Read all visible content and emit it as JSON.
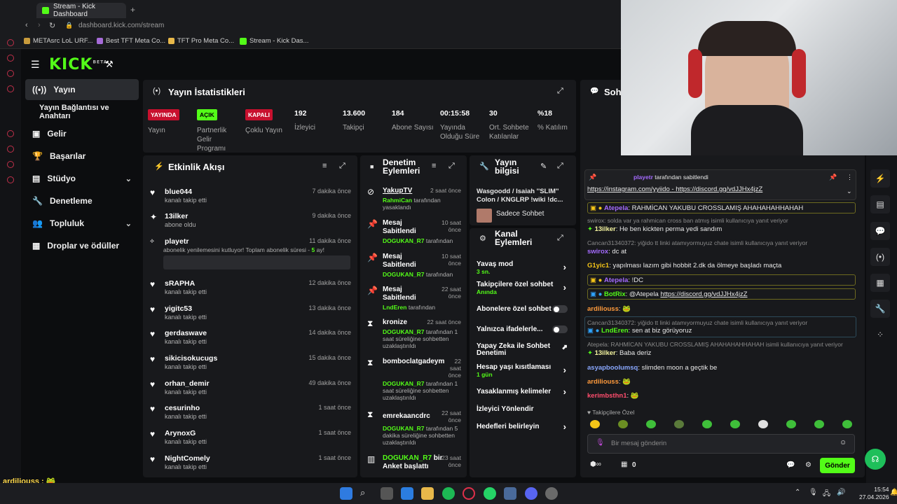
{
  "browser": {
    "tab_title": "Stream - Kick Dashboard",
    "url": "dashboard.kick.com/stream",
    "bookmarks": [
      "METAsrc LoL URF...",
      "Best TFT Meta Co...",
      "TFT Pro Meta Co...",
      "Stream - Kick Das..."
    ]
  },
  "brand": {
    "logo": "KICK",
    "beta": "BETA",
    "accent": "#53fc18"
  },
  "sidebar": {
    "items": [
      {
        "label": "Yayın"
      },
      {
        "label": "Yayın Bağlantısı ve Anahtarı"
      },
      {
        "label": "Gelir"
      },
      {
        "label": "Başarılar"
      },
      {
        "label": "Stüdyo"
      },
      {
        "label": "Denetleme"
      },
      {
        "label": "Topluluk"
      },
      {
        "label": "Droplar ve ödüller"
      }
    ]
  },
  "stats": {
    "title": "Yayın İstatistikleri",
    "items": [
      {
        "value": "YAYINDA",
        "label": "Yayın"
      },
      {
        "value": "AÇIK",
        "label": "Partnerlik Gelir Programı"
      },
      {
        "value": "KAPALI",
        "label": "Çoklu Yayın"
      },
      {
        "value": "192",
        "label": "İzleyici"
      },
      {
        "value": "13.600",
        "label": "Takipçi"
      },
      {
        "value": "184",
        "label": "Abone Sayısı"
      },
      {
        "value": "00:15:58",
        "label": "Yayında Olduğu Süre"
      },
      {
        "value": "30",
        "label": "Ort. Sohbete Katılanlar"
      },
      {
        "value": "%18",
        "label": "% Katılım"
      }
    ]
  },
  "activity": {
    "title": "Etkinlik Akışı",
    "events": [
      {
        "name": "blue044",
        "sub": "kanalı takip etti",
        "time": "7 dakika önce"
      },
      {
        "name": "13ilker",
        "sub": "abone oldu",
        "time": "9 dakika önce"
      },
      {
        "name": "playetr",
        "sub": "abonelik yenilemesini kutluyor! Toplam abonelik süresi -",
        "months": "5",
        "sub2": "ay!",
        "time": "11 dakika önce"
      },
      {
        "name": "sRAPHA",
        "sub": "kanalı takip etti",
        "time": "12 dakika önce"
      },
      {
        "name": "yigitc53",
        "sub": "kanalı takip etti",
        "time": "13 dakika önce"
      },
      {
        "name": "gerdaswave",
        "sub": "kanalı takip etti",
        "time": "14 dakika önce"
      },
      {
        "name": "sikicisokucugs",
        "sub": "kanalı takip etti",
        "time": "15 dakika önce"
      },
      {
        "name": "orhan_demir",
        "sub": "kanalı takip etti",
        "time": "49 dakika önce"
      },
      {
        "name": "cesurinho",
        "sub": "kanalı takip etti",
        "time": "1 saat önce"
      },
      {
        "name": "ArynoxG",
        "sub": "kanalı takip etti",
        "time": "1 saat önce"
      },
      {
        "name": "NightComely",
        "sub": "kanalı takip etti",
        "time": "1 saat önce"
      }
    ]
  },
  "moderation": {
    "title": "Denetim Eylemleri",
    "items": [
      {
        "name": "YakupTV",
        "time": "2 saat önce",
        "by": "RahmiCan",
        "rest": "tarafından yasaklandı"
      },
      {
        "name": "Mesaj Sabitlendi",
        "time": "10 saat önce",
        "by": "DOGUKAN_R7",
        "rest": "tarafından"
      },
      {
        "name": "Mesaj Sabitlendi",
        "time": "10 saat önce",
        "by": "DOGUKAN_R7",
        "rest": "tarafından"
      },
      {
        "name": "Mesaj Sabitlendi",
        "time": "22 saat önce",
        "by": "LndEren",
        "rest": "tarafından"
      },
      {
        "name": "kronize",
        "time": "22 saat önce",
        "by": "DOGUKAN_R7",
        "rest": "tarafından 1 saat süreliğine sohbetten uzaklaştırıldı"
      },
      {
        "name": "bomboclatgadeym",
        "time": "22 saat önce",
        "by": "DOGUKAN_R7",
        "rest": "tarafından 1 saat süreliğine sohbetten uzaklaştırıldı"
      },
      {
        "name": "emrekaancdrc",
        "time": "22 saat önce",
        "by": "DOGUKAN_R7",
        "rest": "tarafından 5 dakika süreliğine sohbetten uzaklaştırıldı"
      },
      {
        "name": "DOGUKAN_R7",
        "extra": "bir",
        "name2": "Anket başlattı",
        "time": "23 saat önce"
      }
    ]
  },
  "info": {
    "title": "Yayın bilgisi",
    "stream_title": "Wasgoodd / Isaiah ''SLIM'' Colon / KNGLRP !wiki !dc...",
    "category": "Sadece Sohbet"
  },
  "channel": {
    "title": "Kanal Eylemleri",
    "items": [
      {
        "label": "Yavaş mod",
        "sub": "3 sn."
      },
      {
        "label": "Takipçilere özel sohbet",
        "sub": "Anında"
      },
      {
        "label": "Abonelere özel sohbet",
        "sub": ""
      },
      {
        "label": "Yalnızca ifadelerle...",
        "sub": ""
      },
      {
        "label": "Yapay Zeka ile Sohbet Denetimi",
        "sub": ""
      },
      {
        "label": "Hesap yaşı kısıtlaması",
        "sub": "1 gün"
      },
      {
        "label": "Yasaklanmış kelimeler",
        "sub": ""
      },
      {
        "label": "İzleyici Yönlendir",
        "sub": ""
      },
      {
        "label": "Hedefleri belirleyin",
        "sub": ""
      }
    ]
  },
  "chat": {
    "title": "Sohbet",
    "pinned": {
      "by": "playetr",
      "rest": "tarafından sabitlendi",
      "link1": "https://instagram.com/yyiido",
      "sep": "-",
      "link2": "https://discord.gg/vdJJHx4jzZ"
    },
    "messages": [
      {
        "user": "Atepela",
        "text": "RAHMİCAN YAKUBU CROSSLAMIŞ AHAHAHAHHAHAH"
      },
      {
        "reply": "swirox: solda var ya rahmican cross ban atmış isimli kullanıcıya yanıt veriyor"
      },
      {
        "user": "13ilker",
        "text": "He ben kickten perma yedi sandım"
      },
      {
        "reply": "Cancan31340372: yiğido tt linki atamıyormuyuz chate isimli kullanıcıya yanıt veriyor"
      },
      {
        "user": "swirox",
        "text": "dc at"
      },
      {
        "user": "G1yic1",
        "text": "yapılması lazım gibi hobbit 2.dk da ölmeye başladı maçta"
      },
      {
        "user": "Atepela",
        "text": "!DC"
      },
      {
        "user": "BotRix",
        "text": "@Atepela",
        "link": "https://discord.gg/vdJJHx4jzZ"
      },
      {
        "user": "ardiliouss",
        "text": ""
      },
      {
        "reply": "Cancan31340372: yiğido tt linki atamıyormuyuz chate isimli kullanıcıya yanıt veriyor"
      },
      {
        "user": "LndEren",
        "text": "sen at biz görüyoruz"
      },
      {
        "reply": "Atepela: RAHMİCAN YAKUBU CROSSLAMIŞ AHAHAHAHHAHAH isimli kullanıcıya yanıt veriyor"
      },
      {
        "user": "13ilker",
        "text": "Baba deriz"
      },
      {
        "user": "asyapboolumsq",
        "text": "slimden moon a geçtik be"
      },
      {
        "user": "ardiliouss",
        "text": ""
      },
      {
        "user": "kerimbsthn1",
        "text": ""
      }
    ],
    "followers_only": "Takipçilere Özel",
    "input_placeholder": "Bir mesaj gönderin",
    "count": "0",
    "send": "Gönder"
  },
  "overlay": {
    "lines": [
      {
        "user": "ardiliouss"
      },
      {
        "user": "kerimbsthn1"
      }
    ]
  },
  "clock": {
    "time": "15:54",
    "date": "27.04.2026"
  }
}
